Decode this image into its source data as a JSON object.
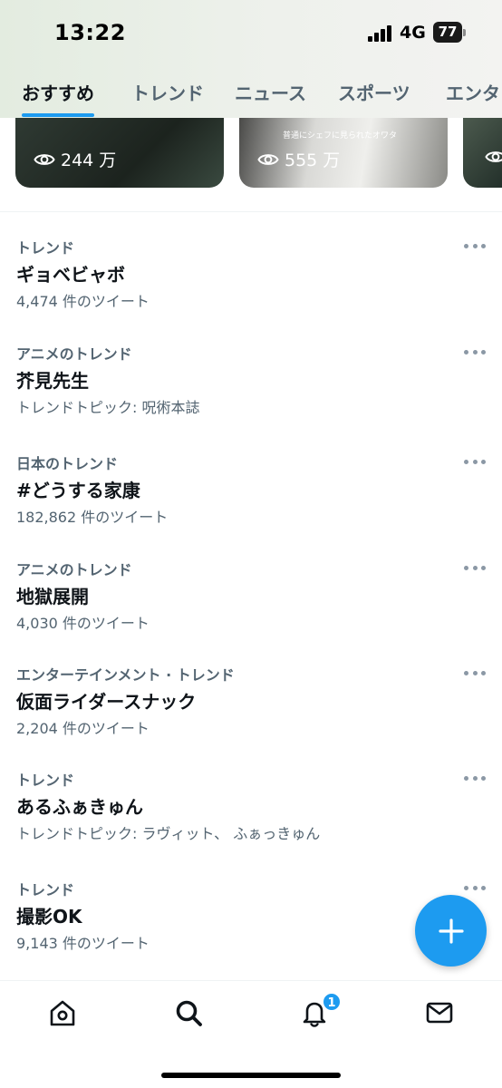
{
  "status_bar": {
    "time": "13:22",
    "network": "4G",
    "battery": "77"
  },
  "tabs": [
    {
      "label": "おすすめ",
      "active": true
    },
    {
      "label": "トレンド",
      "active": false
    },
    {
      "label": "ニュース",
      "active": false
    },
    {
      "label": "スポーツ",
      "active": false
    },
    {
      "label": "エンタ",
      "active": false
    }
  ],
  "media_cards": [
    {
      "views": "244 万"
    },
    {
      "caption": "普通にシェフに見られたオワタ",
      "views": "555 万"
    }
  ],
  "trends": [
    {
      "category": "トレンド",
      "title": "ギョベビャボ",
      "subtitle": "4,474 件のツイート"
    },
    {
      "category": "アニメのトレンド",
      "title": "芥見先生",
      "subtitle": "トレンドトピック: 呪術本誌"
    },
    {
      "category": "日本のトレンド",
      "title": "#どうする家康",
      "subtitle": "182,862 件のツイート"
    },
    {
      "category": "アニメのトレンド",
      "title": "地獄展開",
      "subtitle": "4,030 件のツイート"
    },
    {
      "category": "エンターテインメント · トレンド",
      "title": "仮面ライダースナック",
      "subtitle": "2,204 件のツイート"
    },
    {
      "category": "トレンド",
      "title": "あるふぁきゅん",
      "subtitle": "トレンドトピック: ラヴィット、 ふぁっきゅん"
    },
    {
      "category": "トレンド",
      "title": "撮影OK",
      "subtitle": "9,143 件のツイート"
    }
  ],
  "bottom_nav": {
    "items": [
      {
        "icon": "home-icon"
      },
      {
        "icon": "search-icon"
      },
      {
        "icon": "bell-icon",
        "badge": "1"
      },
      {
        "icon": "mail-icon"
      }
    ]
  },
  "colors": {
    "accent": "#1d9bf0",
    "text_primary": "#0f1419",
    "text_secondary": "#536471"
  }
}
